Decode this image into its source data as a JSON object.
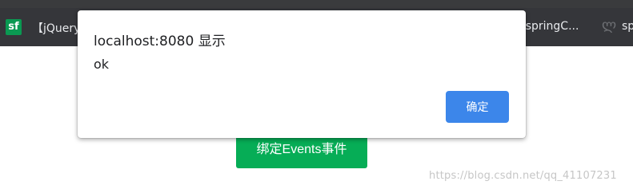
{
  "browser": {
    "bookmarks": {
      "sf_badge": "sf",
      "left_item": "【jQuery",
      "right_item": "/springC...",
      "far_item": "sp"
    }
  },
  "page": {
    "bind_button_label": "绑定Events事件",
    "watermark": "https://blog.csdn.net/qq_41107231"
  },
  "dialog": {
    "title": "localhost:8080 显示",
    "message": "ok",
    "confirm_label": "确定"
  },
  "colors": {
    "accent": "#3c86ea",
    "page_button": "#06ad56",
    "bookmarks_bar": "#35363a"
  }
}
